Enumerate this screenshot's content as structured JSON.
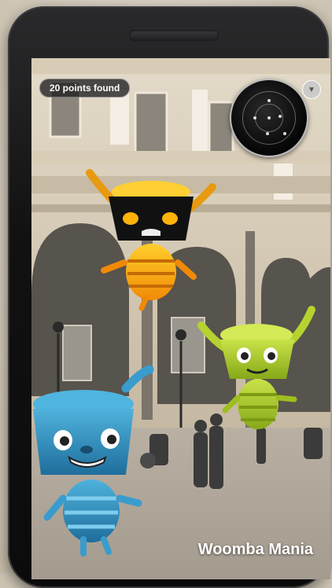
{
  "status": {
    "points_found": "20 points found"
  },
  "brand": {
    "title": "Woomba Mania"
  },
  "icons": {
    "radar": "radar-icon",
    "menu": "chevron-down-icon"
  }
}
